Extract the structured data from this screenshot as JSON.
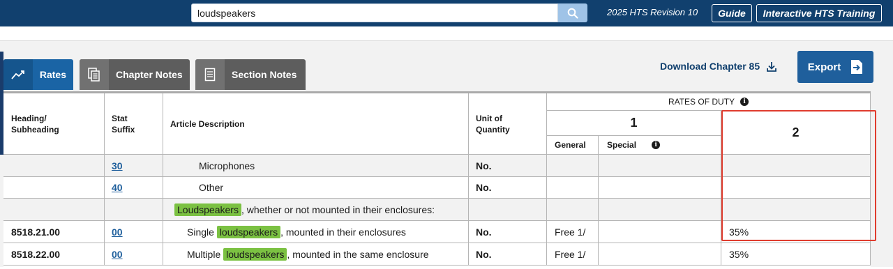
{
  "search": {
    "value": "loudspeakers"
  },
  "header": {
    "revision": "2025 HTS Revision 10",
    "guide_label": "Guide",
    "training_label": "Interactive HTS Training"
  },
  "tabs": [
    {
      "label": "Rates",
      "icon": "trend-chart-icon",
      "active": true
    },
    {
      "label": "Chapter Notes",
      "icon": "document-copy-icon",
      "active": false
    },
    {
      "label": "Section Notes",
      "icon": "document-icon",
      "active": false
    }
  ],
  "toolbar": {
    "download_label": "Download Chapter 85",
    "export_label": "Export"
  },
  "table": {
    "headers": {
      "heading": "Heading/ Subheading",
      "heading_line1": "Heading/",
      "heading_line2": "Subheading",
      "stat_line1": "Stat",
      "stat_line2": "Suffix",
      "description": "Article Description",
      "unit_line1": "Unit of",
      "unit_line2": "Quantity",
      "rates_of_duty": "RATES OF DUTY",
      "col1": "1",
      "col2": "2",
      "general": "General",
      "special": "Special"
    },
    "rows": [
      {
        "heading": "",
        "stat": "30",
        "desc_pre": "Microphones",
        "desc_hl": "",
        "desc_post": "",
        "unit": "No.",
        "general": "",
        "special": "",
        "col2": ""
      },
      {
        "heading": "",
        "stat": "40",
        "desc_pre": "Other",
        "desc_hl": "",
        "desc_post": "",
        "unit": "No.",
        "general": "",
        "special": "",
        "col2": ""
      },
      {
        "heading": "",
        "stat": "",
        "desc_pre": "",
        "desc_hl": "Loudspeakers",
        "desc_post": ", whether or not mounted in their enclosures:",
        "unit": "",
        "general": "",
        "special": "",
        "col2": ""
      },
      {
        "heading": "8518.21.00",
        "stat": "00",
        "desc_pre": "Single ",
        "desc_hl": "loudspeakers",
        "desc_post": ", mounted in their enclosures",
        "unit": "No.",
        "general": "Free 1/",
        "special": "",
        "col2": "35%"
      },
      {
        "heading": "8518.22.00",
        "stat": "00",
        "desc_pre": "Multiple ",
        "desc_hl": "loudspeakers",
        "desc_post": ", mounted in the same enclosure",
        "unit": "No.",
        "general": "Free 1/",
        "special": "",
        "col2": "35%"
      }
    ]
  },
  "colors": {
    "header_bg": "#11406e",
    "highlight": "#7bc142",
    "selection_outline": "#e03c2e",
    "link": "#1f5f9c"
  }
}
